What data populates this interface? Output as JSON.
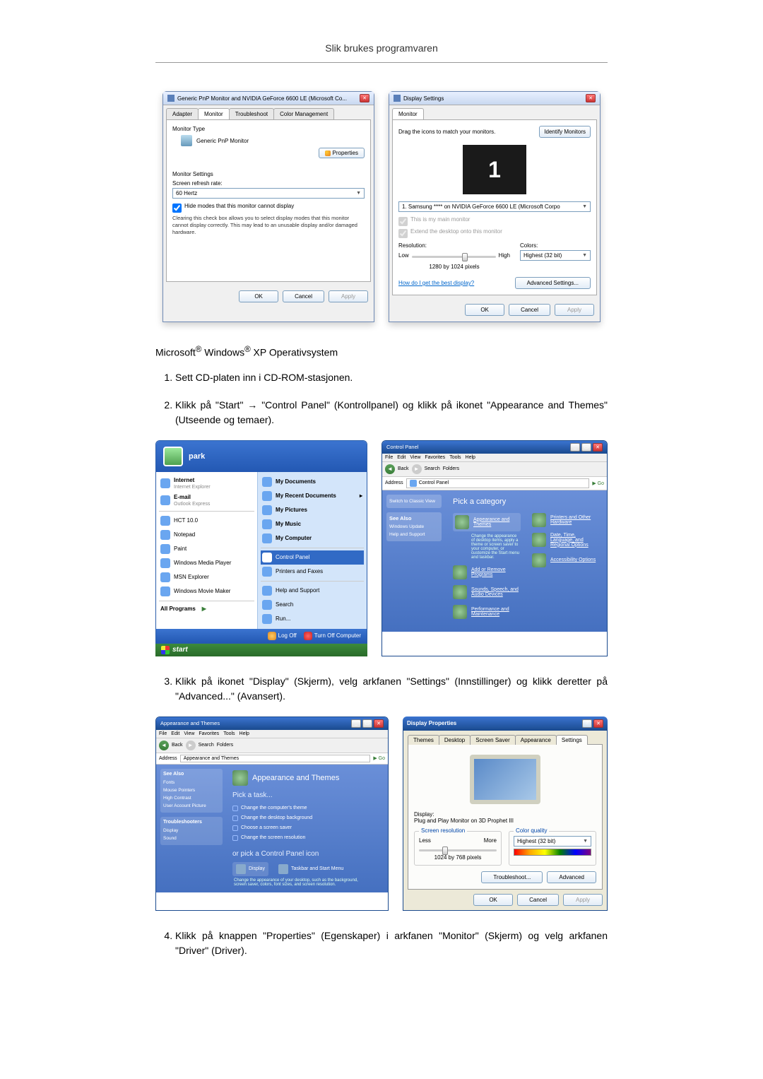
{
  "header": "Slik brukes programvaren",
  "fig1": {
    "left": {
      "title": "Generic PnP Monitor and NVIDIA GeForce 6600 LE (Microsoft Co...",
      "tabs": [
        "Adapter",
        "Monitor",
        "Troubleshoot",
        "Color Management"
      ],
      "active_tab": "Monitor",
      "monitor_type_label": "Monitor Type",
      "monitor_type_value": "Generic PnP Monitor",
      "properties_btn": "Properties",
      "monitor_settings_label": "Monitor Settings",
      "refresh_label": "Screen refresh rate:",
      "refresh_value": "60 Hertz",
      "hide_modes_label": "Hide modes that this monitor cannot display",
      "hide_modes_desc": "Clearing this check box allows you to select display modes that this monitor cannot display correctly. This may lead to an unusable display and/or damaged hardware.",
      "ok": "OK",
      "cancel": "Cancel",
      "apply": "Apply"
    },
    "right": {
      "title": "Display Settings",
      "tab": "Monitor",
      "drag_text": "Drag the icons to match your monitors.",
      "identify_btn": "Identify Monitors",
      "monitor_number": "1",
      "monitor_select": "1. Samsung **** on NVIDIA GeForce 6600 LE (Microsoft Corpo",
      "main_monitor": "This is my main monitor",
      "extend_desktop": "Extend the desktop onto this monitor",
      "resolution_label": "Resolution:",
      "low": "Low",
      "high": "High",
      "resolution_value": "1280 by 1024 pixels",
      "colors_label": "Colors:",
      "colors_value": "Highest (32 bit)",
      "best_display_link": "How do I get the best display?",
      "advanced_btn": "Advanced Settings...",
      "ok": "OK",
      "cancel": "Cancel",
      "apply": "Apply"
    }
  },
  "os_line": {
    "prefix": "Microsoft",
    "mid": " Windows",
    "suffix": " XP Operativsystem"
  },
  "steps": {
    "s1": "Sett CD-platen inn i CD-ROM-stasjonen.",
    "s2": "Klikk på \"Start\" → \"Control Panel\" (Kontrollpanel) og klikk på ikonet \"Appearance and Themes\" (Utseende og temaer).",
    "s3": "Klikk på ikonet \"Display\" (Skjerm), velg arkfanen \"Settings\" (Innstillinger) og klikk deretter på \"Advanced...\" (Avansert).",
    "s4": "Klikk på knappen \"Properties\" (Egenskaper) i arkfanen \"Monitor\" (Skjerm) og velg arkfanen \"Driver\" (Driver)."
  },
  "startmenu": {
    "user": "park",
    "left_items_top": [
      {
        "title": "Internet",
        "sub": "Internet Explorer"
      },
      {
        "title": "E-mail",
        "sub": "Outlook Express"
      }
    ],
    "left_items": [
      "HCT 10.0",
      "Notepad",
      "Paint",
      "Windows Media Player",
      "MSN Explorer",
      "Windows Movie Maker"
    ],
    "all_programs": "All Programs",
    "right_items_bold": [
      "My Documents",
      "My Recent Documents",
      "My Pictures",
      "My Music",
      "My Computer"
    ],
    "right_items": [
      "Control Panel",
      "Printers and Faxes",
      "Help and Support",
      "Search",
      "Run..."
    ],
    "logoff": "Log Off",
    "turnoff": "Turn Off Computer",
    "start": "start"
  },
  "cp": {
    "title": "Control Panel",
    "menus": [
      "File",
      "Edit",
      "View",
      "Favorites",
      "Tools",
      "Help"
    ],
    "back": "Back",
    "search": "Search",
    "folders": "Folders",
    "address_label": "Address",
    "address_value": "Control Panel",
    "go": "Go",
    "side_switch": "Switch to Classic View",
    "see_also": "See Also",
    "side_items": [
      "Windows Update",
      "Help and Support"
    ],
    "heading": "Pick a category",
    "categories": [
      "Appearance and Themes",
      "Printers and Other Hardware",
      "Add or Remove Programs",
      "Date, Time, Language, and Regional Options",
      "Sounds, Speech, and Audio Devices",
      "Accessibility Options",
      "Performance and Maintenance"
    ],
    "cat_desc": "Change the appearance of desktop items, apply a theme or screen saver to your computer, or customize the Start menu and taskbar."
  },
  "at": {
    "title": "Appearance and Themes",
    "address_value": "Appearance and Themes",
    "see_also": "See Also",
    "see_items": [
      "Fonts",
      "Mouse Pointers",
      "High Contrast",
      "User Account Picture"
    ],
    "troubleshooters": "Troubleshooters",
    "ts_items": [
      "Display",
      "Sound"
    ],
    "heading": "Appearance and Themes",
    "pick_task": "Pick a task...",
    "tasks": [
      "Change the computer's theme",
      "Change the desktop background",
      "Choose a screen saver",
      "Change the screen resolution"
    ],
    "or_pick": "or pick a Control Panel icon",
    "icons": [
      "Display",
      "Taskbar and Start Menu"
    ],
    "icon_desc": "Change the appearance of your desktop, such as the background, screen saver, colors, font sizes, and screen resolution."
  },
  "dp": {
    "title": "Display Properties",
    "tabs": [
      "Themes",
      "Desktop",
      "Screen Saver",
      "Appearance",
      "Settings"
    ],
    "active_tab": "Settings",
    "display_label": "Display:",
    "display_value": "Plug and Play Monitor on 3D Prophet III",
    "screen_res": "Screen resolution",
    "less": "Less",
    "more": "More",
    "res_value": "1024 by 768 pixels",
    "color_quality": "Color quality",
    "color_value": "Highest (32 bit)",
    "troubleshoot": "Troubleshoot...",
    "advanced": "Advanced",
    "ok": "OK",
    "cancel": "Cancel",
    "apply": "Apply"
  }
}
